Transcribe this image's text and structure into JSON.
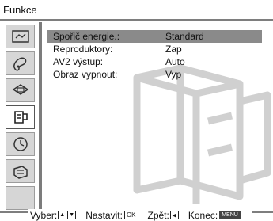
{
  "header": {
    "title": "Funkce"
  },
  "sidebar": {
    "items": [
      {
        "icon": "picture-icon"
      },
      {
        "icon": "sound-icon"
      },
      {
        "icon": "screen-icon"
      },
      {
        "icon": "features-icon",
        "selected": true
      },
      {
        "icon": "timer-icon"
      },
      {
        "icon": "setup-icon"
      }
    ]
  },
  "menu": {
    "rows": [
      {
        "label": "Spořič energie.:",
        "value": "Standard",
        "selected": true
      },
      {
        "label": "Reproduktory:",
        "value": "Zap"
      },
      {
        "label": "AV2 výstup:",
        "value": "Auto"
      },
      {
        "label": "Obraz vypnout:",
        "value": "Vyp"
      }
    ]
  },
  "footer": {
    "select_label": "Vyber:",
    "set_label": "Nastavit:",
    "set_key": "OK",
    "back_label": "Zpět:",
    "end_label": "Konec:",
    "end_key": "MENU"
  },
  "colors": {
    "highlight": "#8a8a8a",
    "rule": "#7e7e7e",
    "icon_bg": "#d6d6d6"
  }
}
